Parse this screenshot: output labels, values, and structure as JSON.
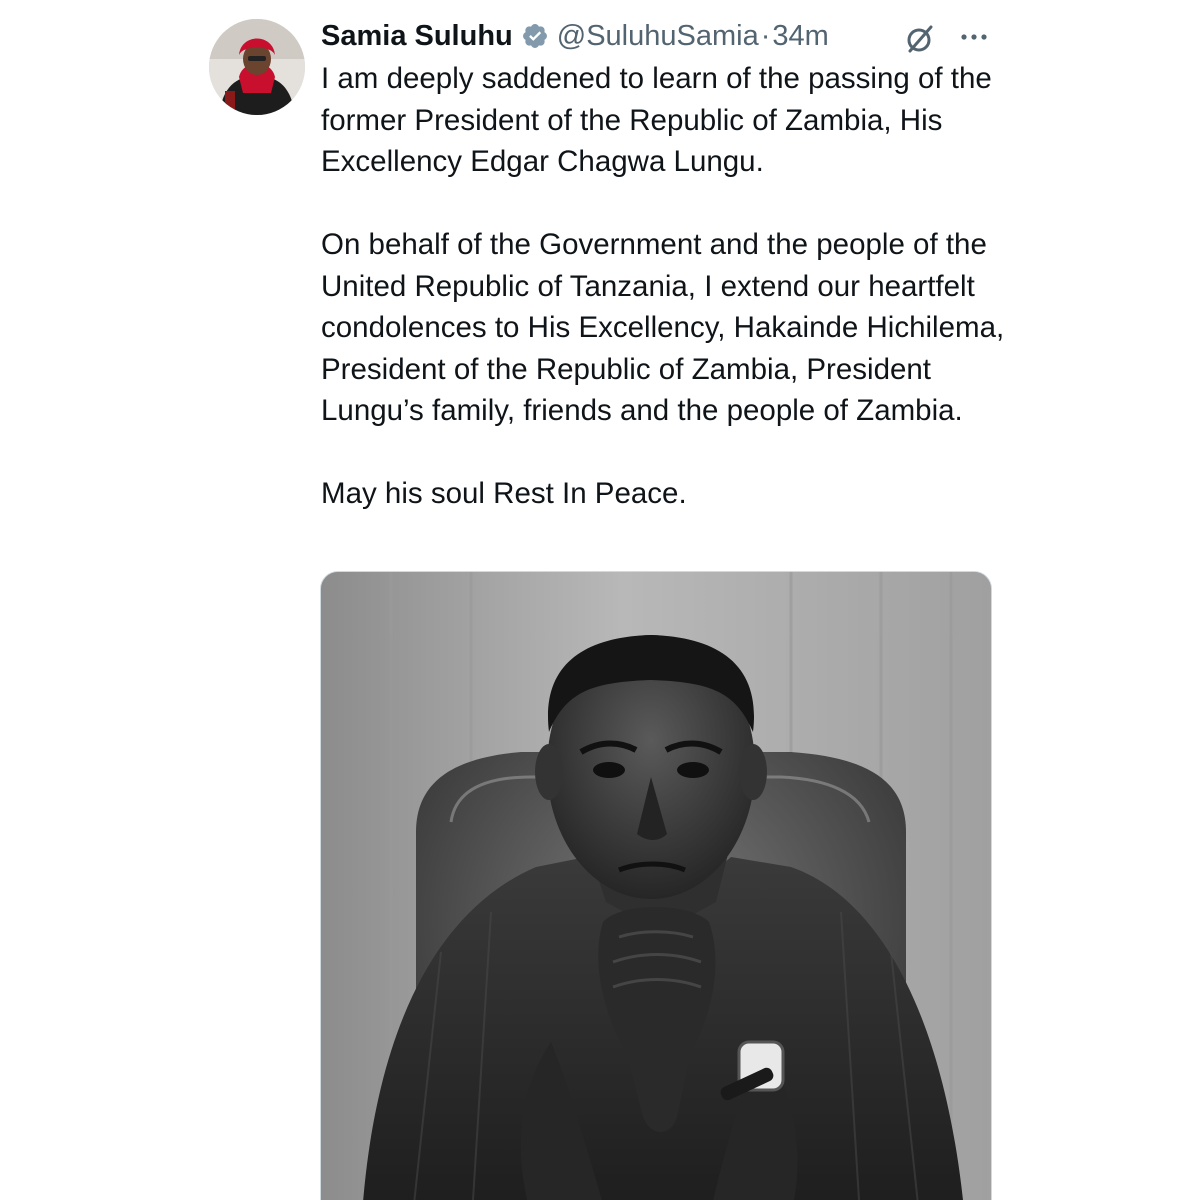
{
  "author": {
    "name": "Samia Suluhu",
    "handle": "@SuluhuSamia",
    "separator": "·",
    "time": "34m",
    "verified": true,
    "verified_color": "#829aab"
  },
  "icons": {
    "verified": "verified-badge-icon",
    "grok": "grok-icon",
    "more": "more-icon"
  },
  "tweet": {
    "paragraphs": [
      "I am deeply saddened to learn of the passing of the former President of the Republic of Zambia, His Excellency Edgar Chagwa Lungu.",
      "On behalf of the Government and the people of the United Republic of Tanzania, I extend our heartfelt condolences to His Excellency, Hakainde Hichilema, President of the Republic of Zambia, President Lungu’s family, friends and the people of Zambia.",
      "May his soul Rest In Peace."
    ]
  },
  "colors": {
    "text": "#0f1419",
    "secondary": "#536471",
    "background": "#ffffff"
  }
}
